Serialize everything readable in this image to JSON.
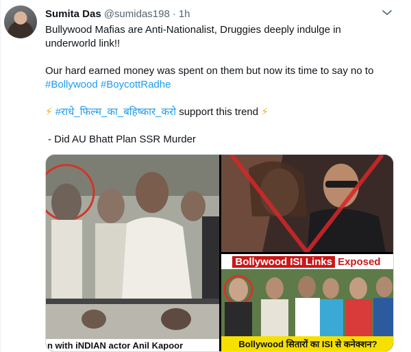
{
  "user": {
    "display_name": "Sumita Das",
    "handle": "@sumidas198",
    "separator": "·",
    "time": "1h"
  },
  "more_icon": "more-horizontal-icon",
  "tweet": {
    "line1": "Bullywood Mafias are Anti-Nationalist, Druggies deeply indulge in",
    "line2": "underworld link!!",
    "line3": "Our hard earned money was spent on them but now its time to say no to",
    "hashtag1": "#Bollywood",
    "hashtag2": "#BoycottRadhe",
    "bolt": "⚡",
    "hindi_hashtag": "#राधे_फिल्म_का_बहिष्कार_करो",
    "trend_text": "support this trend",
    "quote_line": "- Did AU Bhatt Plan SSR Murder"
  },
  "media": {
    "left_caption": "n with iNDIAN actor Anil Kapoor",
    "right_caption_part1": "Bollywood ISI Links",
    "right_caption_part2": "Exposed",
    "bottom_caption": "Bollywood सितारों का ISI से कनेक्शन?"
  },
  "colors": {
    "link": "#1d9bf0",
    "secondary_text": "#536471",
    "red_caption": "#c81818",
    "yellow_caption": "#f6e000"
  }
}
